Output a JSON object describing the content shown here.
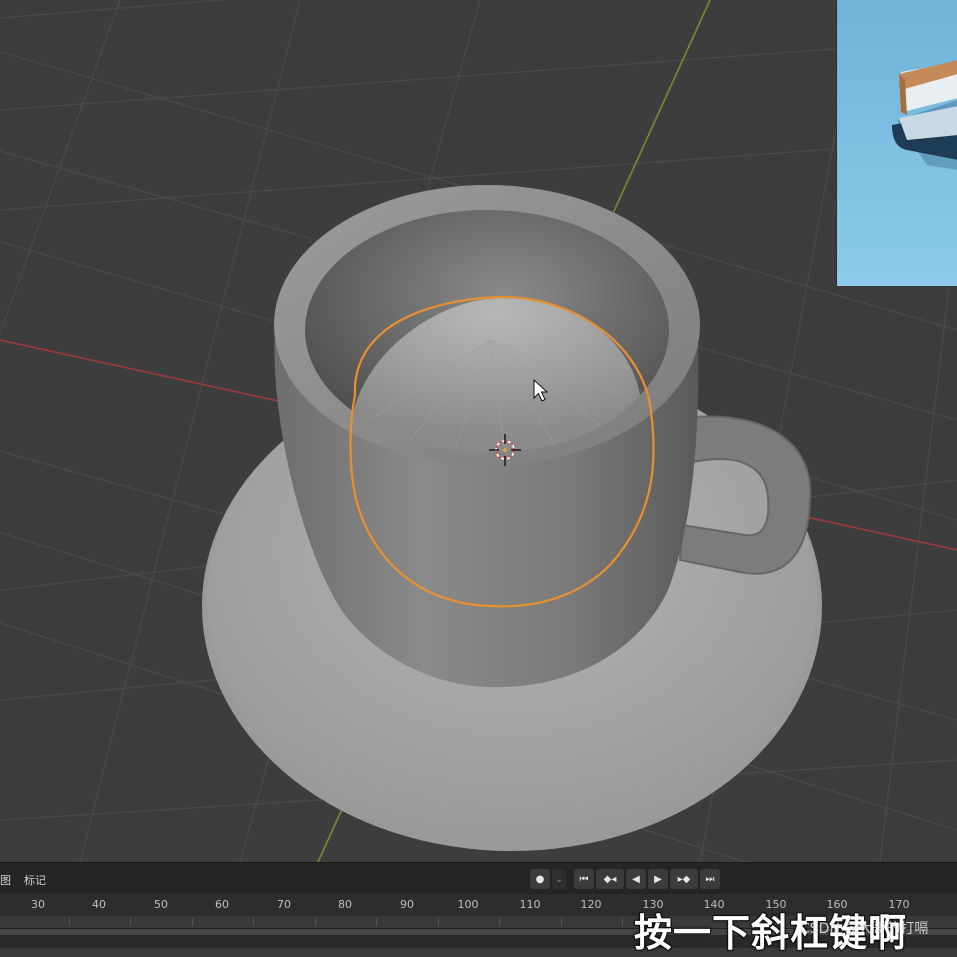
{
  "timeline": {
    "menu_view": "图",
    "menu_marker": "标记",
    "ruler_ticks": [
      "30",
      "40",
      "50",
      "60",
      "70",
      "80",
      "90",
      "100",
      "110",
      "120",
      "130",
      "140",
      "150",
      "160",
      "170"
    ]
  },
  "playback": {
    "record_icon": "record-dot-icon",
    "jump_start_icon": "jump-to-start-icon",
    "prev_keyframe_icon": "previous-keyframe-icon",
    "play_reverse_icon": "play-reverse-icon",
    "play_icon": "play-icon",
    "next_keyframe_icon": "next-keyframe-icon",
    "jump_end_icon": "jump-to-end-icon"
  },
  "overlay": {
    "subtitle": "按一下斜杠键啊",
    "watermark": "CSDN @大哥的打嗝"
  },
  "viewport": {
    "object": "cup-and-saucer",
    "selection_color": "#e8902f",
    "x_axis_color": "#9c3a3a",
    "y_axis_color": "#7a8a2c",
    "background_color": "#3d3d3d"
  }
}
